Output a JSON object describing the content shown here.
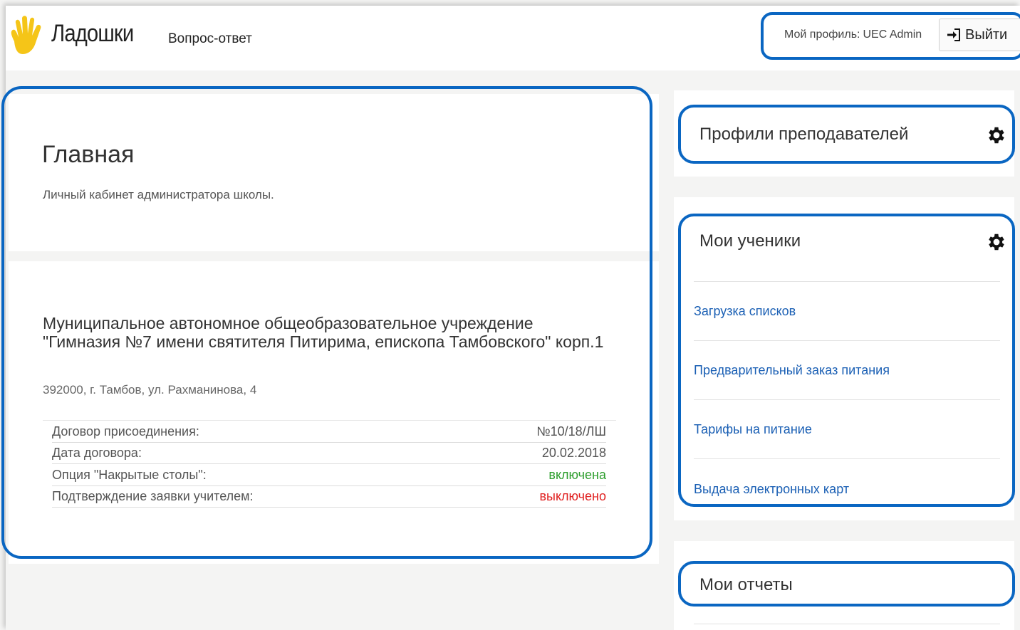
{
  "header": {
    "logo_text": "Ладошки",
    "nav_link": "Вопрос-ответ",
    "profile_label": "Мой профиль:",
    "profile_user": "UEC Admin",
    "logout_label": "Выйти"
  },
  "main": {
    "title": "Главная",
    "subtitle": "Личный кабинет администратора школы.",
    "school_name": "Муниципальное автономное общеобразовательное учреждение \"Гимназия №7 имени святителя Питирима, епископа Тамбовского\" корп.1",
    "school_address": "392000, г. Тамбов, ул. Рахманинова, 4",
    "info_rows": [
      {
        "label": "Договор присоединения:",
        "value": "№10/18/ЛШ",
        "status": "normal"
      },
      {
        "label": "Дата договора:",
        "value": "20.02.2018",
        "status": "normal"
      },
      {
        "label": "Опция \"Накрытые столы\":",
        "value": "включена",
        "status": "on"
      },
      {
        "label": "Подтверждение заявки учителем:",
        "value": "выключено",
        "status": "off"
      }
    ]
  },
  "sidebar": {
    "teachers": {
      "title": "Профили преподавателей",
      "icon": "gear-icon"
    },
    "students": {
      "title": "Мои ученики",
      "icon": "gear-icon",
      "links": [
        "Загрузка списков",
        "Предварительный заказ питания",
        "Тарифы на питание",
        "Выдача электронных карт"
      ]
    },
    "reports": {
      "title": "Мои отчеты"
    }
  },
  "colors": {
    "accent_outline": "#0a66c2",
    "link": "#1a5fb4",
    "enabled": "#2e9e2e",
    "disabled": "#e02020",
    "logo_hand": "#f5c518"
  }
}
